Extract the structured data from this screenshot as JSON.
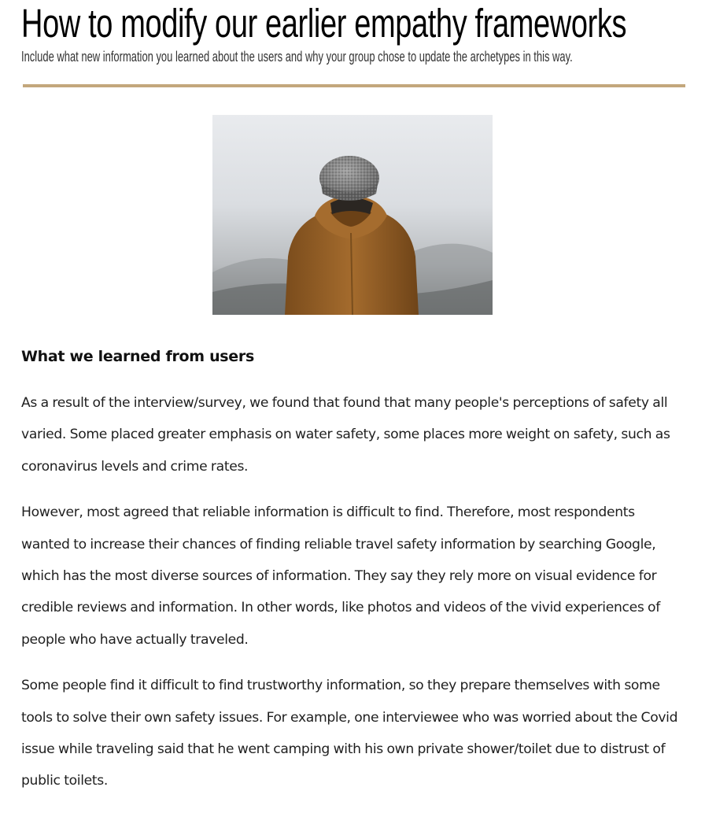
{
  "header": {
    "title": "How to modify our earlier empathy frameworks",
    "subtitle": "Include what new information you learned about the users and why your group chose to update the archetypes in this way."
  },
  "colors": {
    "rule": "#c3a77c",
    "jacket": "#9b6529",
    "beanie": "#7d7d7d"
  },
  "hero": {
    "icon": "person-in-beanie-photo"
  },
  "section": {
    "heading": "What we learned from users",
    "paragraphs": [
      "As a result of the interview/survey, we found that found that many people's perceptions of safety all varied. Some placed greater emphasis on water safety, some places more weight on safety, such as coronavirus levels and crime rates.",
      "However, most agreed that reliable information is difficult to find. Therefore, most respondents wanted to increase their chances of finding reliable travel safety information by searching Google, which has the most diverse sources of information. They say they rely more on visual evidence for credible reviews and information. In other words, like photos and videos of the vivid experiences of people who have actually traveled.",
      "Some people find it difficult to find trustworthy information, so they prepare themselves with some tools to solve their own safety issues. For example, one interviewee who was worried about the Covid issue while traveling said that he went camping with his own private shower/toilet due to distrust of public toilets."
    ]
  }
}
